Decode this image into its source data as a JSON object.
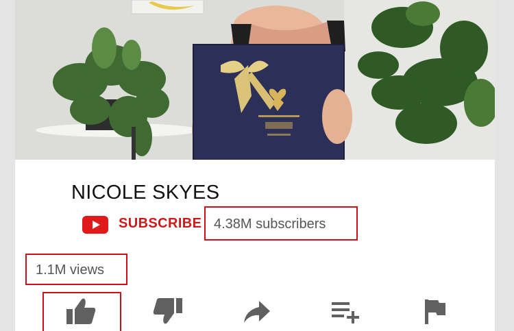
{
  "channel": {
    "name": "NICOLE SKYES",
    "subscribe_label": "SUBSCRIBE",
    "subscribers": "4.38M subscribers"
  },
  "video": {
    "views": "1.1M views"
  },
  "actions": [
    {
      "name": "like",
      "icon": "thumbs-up-icon"
    },
    {
      "name": "dislike",
      "icon": "thumbs-down-icon"
    },
    {
      "name": "share",
      "icon": "share-icon"
    },
    {
      "name": "save",
      "icon": "playlist-add-icon"
    },
    {
      "name": "report",
      "icon": "flag-icon"
    }
  ],
  "colors": {
    "brand_red": "#cc1a1a",
    "highlight_red": "#d10f1a",
    "icon_gray": "#606060"
  }
}
